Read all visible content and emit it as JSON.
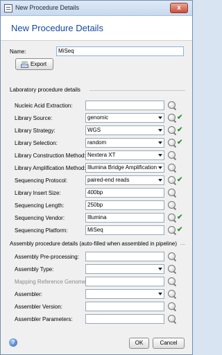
{
  "window": {
    "title": "New Procedure Details",
    "close_glyph": "x"
  },
  "header": {
    "title": "New Procedure Details"
  },
  "name_row": {
    "label": "Name:",
    "value": "MiSeq"
  },
  "export_button": {
    "label": "Export",
    "icon": "export-icon"
  },
  "lab_section": {
    "title": "Laboratory procedure details",
    "fields": [
      {
        "label": "Nucleic Acid Extraction:",
        "value": "",
        "type": "text"
      },
      {
        "label": "Library Source:",
        "value": "genomic",
        "type": "combo"
      },
      {
        "label": "Library Strategy:",
        "value": "WGS",
        "type": "combo"
      },
      {
        "label": "Library Selection:",
        "value": "random",
        "type": "combo"
      },
      {
        "label": "Library Construction Method:",
        "value": "Nextera XT",
        "type": "combo"
      },
      {
        "label": "Library Amplification Method:",
        "value": "Illumina Bridge Amplification",
        "type": "combo"
      },
      {
        "label": "Sequencing Protocol:",
        "value": "paired-end reads",
        "type": "combo"
      },
      {
        "label": "Library Insert Size:",
        "value": "400bp",
        "type": "text"
      },
      {
        "label": "Sequencing Length:",
        "value": "250bp",
        "type": "text"
      },
      {
        "label": "Sequencing Vendor:",
        "value": "Illumina",
        "type": "text"
      },
      {
        "label": "Sequencing Platform:",
        "value": "MiSeq",
        "type": "text"
      }
    ]
  },
  "assembly_section": {
    "title": "Assembly procedure details (auto-filled when assembled in pipeline)",
    "fields": [
      {
        "label": "Assembly Pre-processing:",
        "value": "",
        "type": "text"
      },
      {
        "label": "Assembly Type:",
        "value": "",
        "type": "combo"
      },
      {
        "label": "Mapping Reference Genome:",
        "value": "",
        "type": "text",
        "disabled": true
      },
      {
        "label": "Assembler:",
        "value": "",
        "type": "combo"
      },
      {
        "label": "Assembler Version:",
        "value": "",
        "type": "text"
      },
      {
        "label": "Assembler Parameters:",
        "value": "",
        "type": "text"
      }
    ]
  },
  "footer": {
    "ok_label": "OK",
    "cancel_label": "Cancel",
    "help_glyph": "?"
  },
  "colors": {
    "accent": "#15479c",
    "ok_check": "#2f8f2f",
    "close": "#c94f37"
  }
}
